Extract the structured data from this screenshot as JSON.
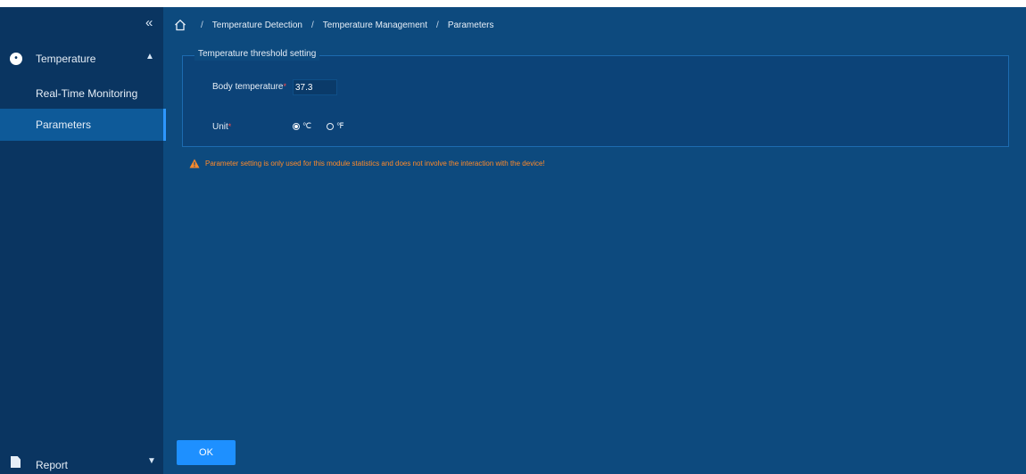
{
  "sidebar": {
    "collapse_label": "«",
    "groups": [
      {
        "icon": "temperature-shield-icon",
        "label": "Temperature",
        "expanded": true,
        "items": [
          {
            "label": "Real-Time Monitoring",
            "active": false
          },
          {
            "label": "Parameters",
            "active": true
          }
        ]
      },
      {
        "icon": "document-icon",
        "label": "Report",
        "expanded": false
      }
    ]
  },
  "breadcrumb": {
    "home_icon": "home-icon",
    "items": [
      "Temperature Detection",
      "Temperature Management",
      "Parameters"
    ]
  },
  "settings": {
    "legend": "Temperature threshold setting",
    "body_temperature_label": "Body temperature",
    "body_temperature_value": "37.3",
    "unit_label": "Unit",
    "units": [
      {
        "label": "℃",
        "checked": true
      },
      {
        "label": "℉",
        "checked": false
      }
    ]
  },
  "warning": {
    "icon": "warning-icon",
    "text": "Parameter setting is only used for this module statistics and does not involve the interaction with the device!"
  },
  "actions": {
    "ok_label": "OK"
  },
  "colors": {
    "background": "#0d4a7e",
    "sidebar": "#0a3561",
    "accent": "#1e90ff",
    "warning": "#ff8a2a",
    "required": "#ff4a4a"
  }
}
